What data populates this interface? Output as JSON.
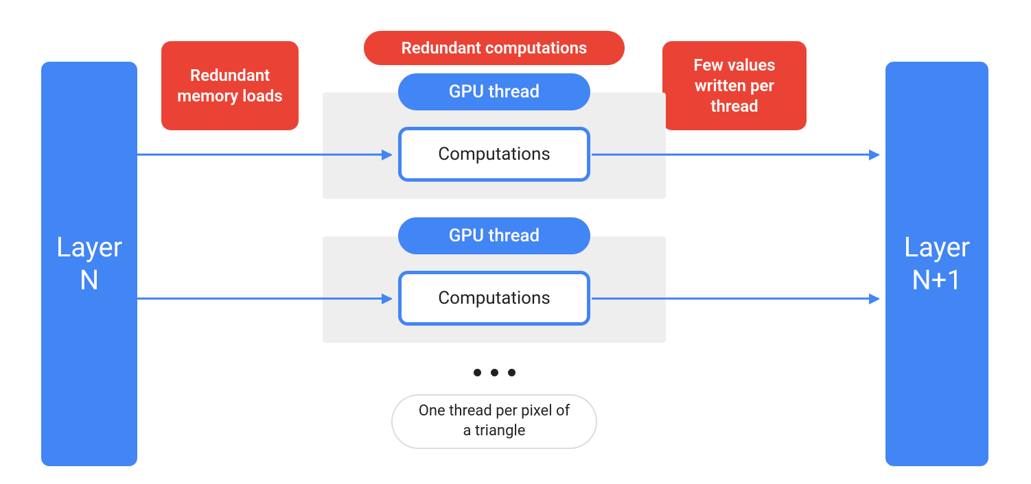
{
  "colors": {
    "blue": "#4285f4",
    "red": "#ea4335",
    "grey": "#eeeeee",
    "border_grey": "#dadce0",
    "text_dark": "#202124"
  },
  "layer_left": {
    "label": "Layer\nN"
  },
  "layer_right": {
    "label": "Layer\nN+1"
  },
  "callouts": {
    "redundant_memory": "Redundant memory loads",
    "redundant_comp": "Redundant computations",
    "few_values": "Few values written per thread"
  },
  "threads": [
    {
      "header": "GPU thread",
      "box": "Computations"
    },
    {
      "header": "GPU thread",
      "box": "Computations"
    }
  ],
  "footer_note": "One thread per pixel of a triangle",
  "ellipsis": "•••"
}
